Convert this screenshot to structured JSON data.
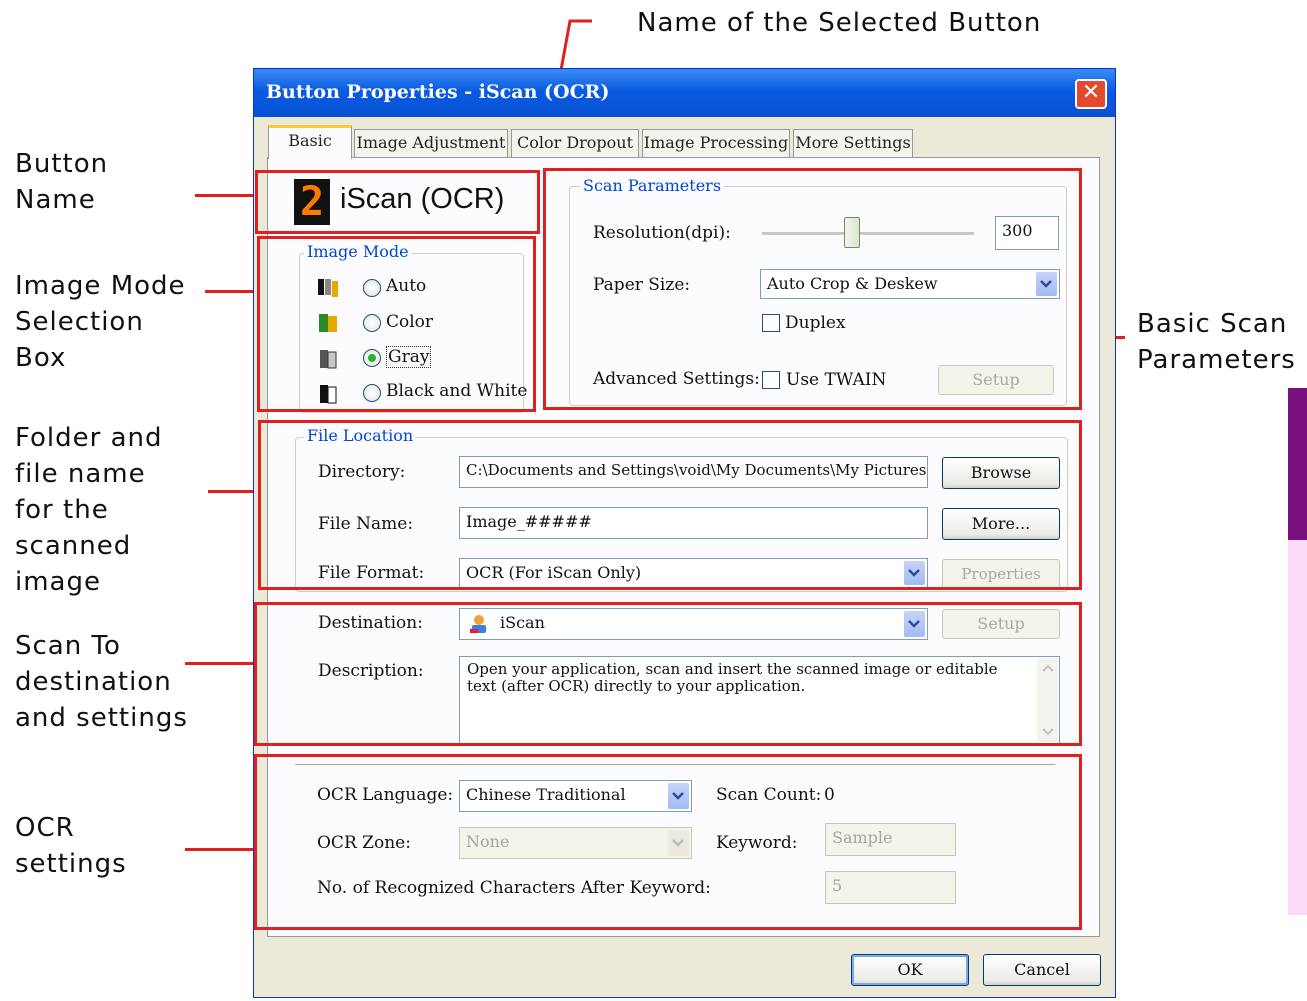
{
  "callouts": {
    "selected_button": "Name of the Selected Button",
    "button_name": "Button\nName",
    "image_mode": "Image Mode\nSelection\nBox",
    "folder_file": "Folder and\nfile name\nfor the\nscanned\nimage",
    "scan_to": "Scan To\ndestination\nand settings",
    "ocr_settings": "OCR\nsettings",
    "basic_scan": "Basic Scan\nParameters"
  },
  "window": {
    "title": "Button Properties - iScan (OCR)",
    "close_glyph": "✕"
  },
  "tabs": [
    {
      "label": "Basic"
    },
    {
      "label": "Image Adjustment"
    },
    {
      "label": "Color Dropout"
    },
    {
      "label": "Image Processing"
    },
    {
      "label": "More Settings"
    }
  ],
  "button_name": {
    "number": "2",
    "label": "iScan (OCR)"
  },
  "image_mode": {
    "title": "Image Mode",
    "options": [
      {
        "label": "Auto",
        "checked": false
      },
      {
        "label": "Color",
        "checked": false
      },
      {
        "label": "Gray",
        "checked": true
      },
      {
        "label": "Black and White",
        "checked": false
      }
    ]
  },
  "scan_params": {
    "title": "Scan Parameters",
    "resolution_label": "Resolution(dpi):",
    "resolution_value": "300",
    "paper_size_label": "Paper Size:",
    "paper_size_value": "Auto Crop & Deskew",
    "duplex_label": "Duplex",
    "advanced_label": "Advanced Settings:",
    "use_twain_label": "Use TWAIN",
    "setup_label": "Setup"
  },
  "file_location": {
    "title": "File Location",
    "directory_label": "Directory:",
    "directory_value": "C:\\Documents and Settings\\void\\My Documents\\My Pictures",
    "browse_label": "Browse",
    "file_name_label": "File Name:",
    "file_name_value": "Image_#####",
    "more_label": "More...",
    "file_format_label": "File Format:",
    "file_format_value": "OCR (For iScan Only)",
    "properties_label": "Properties"
  },
  "destination": {
    "destination_label": "Destination:",
    "destination_value": "iScan",
    "setup_label": "Setup",
    "description_label": "Description:",
    "description_value": "Open your application, scan and insert the scanned image or editable text (after OCR) directly to your application."
  },
  "ocr": {
    "language_label": "OCR Language:",
    "language_value": "Chinese Traditional",
    "scan_count_label": "Scan Count:",
    "scan_count_value": "0",
    "zone_label": "OCR Zone:",
    "zone_value": "None",
    "keyword_label": "Keyword:",
    "keyword_value": "Sample",
    "chars_label": "No. of Recognized Characters After Keyword:",
    "chars_value": "5"
  },
  "footer": {
    "ok_label": "OK",
    "cancel_label": "Cancel"
  },
  "colors": {
    "annotation_red": "#e02020",
    "title_blue": "#0a5be0",
    "group_title_blue": "#0046d5",
    "strip_purple": "#7a0f7f",
    "strip_pink": "#fadcf8"
  }
}
